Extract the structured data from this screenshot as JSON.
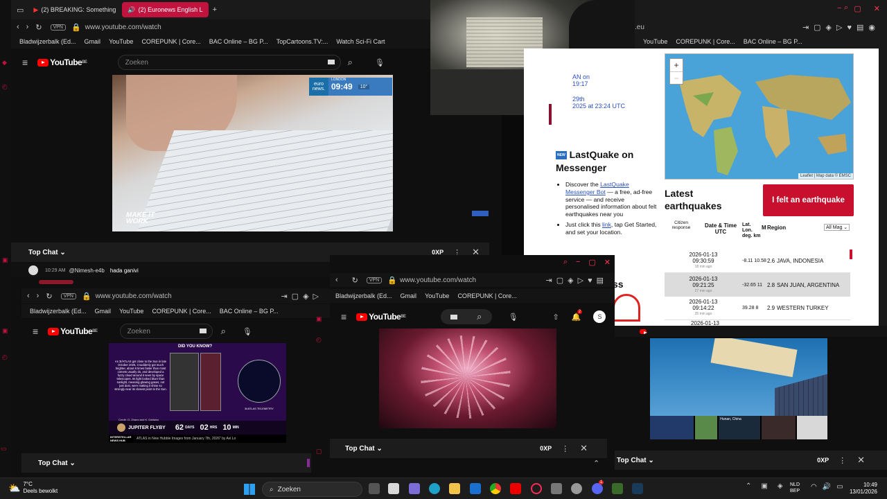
{
  "top_left_window": {
    "tabs": [
      "(2) BREAKING: Something",
      "(2) Euronews English L"
    ],
    "vpn": "VPN",
    "url": "www.youtube.com/watch",
    "bookmarks": [
      "Bladwijzerbalk (Ed...",
      "Gmail",
      "YouTube",
      "COREPUNK | Core...",
      "BAC Online – BG P...",
      "TopCartoons.TV:...",
      "Watch Sci-Fi Cart"
    ],
    "search_placeholder": "Zoeken",
    "badge": "BE",
    "logo": "YouTube",
    "overlay_city": "LONDON",
    "overlay_time": "09:49",
    "overlay_temp": "10°",
    "overlay_brand": "euro news.",
    "caption": "MAKE IT WORK",
    "chat_title": "Top Chat",
    "xp": "0XP",
    "chat_time": "10:29 AM",
    "chat_user": "@Nimesh-e4b",
    "chat_msg": "hada ganivi"
  },
  "right_window": {
    "url_tail": ".eu",
    "bookmarks": [
      "YouTube",
      "COREPUNK | Core...",
      "BAC Online – BG P..."
    ],
    "sidebar_snippets": [
      "AN on",
      "19:17",
      "29th",
      "2025 at 23:24 UTC"
    ],
    "messenger_title": "LastQuake on Messenger",
    "messenger_badge": "NEW",
    "messenger_item1_pre": "Discover the",
    "messenger_item1_link": "LastQuake Messenger Bot",
    "messenger_item1_post": "— a free, ad-free service — and receive personalised information about felt earthquakes near you",
    "messenger_item2_pre": "Just click this",
    "messenger_item2_link": "link",
    "messenger_item2_post": ", tap Get Started, and set your location.",
    "map_attrib": "Leaflet | Map data © EMSC",
    "zoom_in": "+",
    "zoom_out": "−",
    "latest_title": "Latest earthquakes",
    "felt_button": "I felt an earthquake",
    "col_citizen": "Citizen response",
    "col_datetime": "Date & Time UTC",
    "col_latlon": "Lat. Lon. deg. km",
    "col_mag": "M",
    "col_region": "Region",
    "mag_filter": "All Mag",
    "quakes": [
      {
        "date": "2026-01-13",
        "time": "09:30:59",
        "ago": "18 min ago",
        "latlon": "-8.11 10.58",
        "mag": "2.6",
        "region": "JAVA, INDONESIA"
      },
      {
        "date": "2026-01-13",
        "time": "09:21:25",
        "ago": "27 min ago",
        "latlon": "-32.65 11",
        "mag": "2.8",
        "region": "SAN JUAN, ARGENTINA"
      },
      {
        "date": "2026-01-13",
        "time": "09:14:22",
        "ago": "35 min ago",
        "latlon": "39.28 8",
        "mag": "2.9",
        "region": "WESTERN TURKEY"
      },
      {
        "date": "2026-01-13",
        "time": "",
        "ago": "",
        "latlon": "",
        "mag": "",
        "region": ""
      }
    ],
    "section_tail": "ss"
  },
  "bottom_left_window": {
    "url": "www.youtube.com/watch",
    "vpn": "VPN",
    "bookmarks": [
      "Bladwijzerbalk (Ed...",
      "Gmail",
      "YouTube",
      "COREPUNK | Core...",
      "BAC Online – BG P..."
    ],
    "search_placeholder": "Zoeken",
    "logo": "YouTube",
    "badge": "BE",
    "did_you_know": "DID YOU KNOW?",
    "fact": "As 3I/ATLAS got close to the Sun in late October 2025, it suddenly got much brighter, about 8 times faster than most comets usually do, and developed a fuzzy cloud around it seen by space telescopes. Its light looked bluer than sunlight, meaning glowing gases, not just dust, were making it shine so strongly near its closest point to the Sun.",
    "credit": "Credit: Q. Zhang and K. Dattaino",
    "telemetry": "3I/ATLAS TELEMETRY",
    "jupiter_label": "JUPITER FLYBY",
    "days": "62",
    "days_label": "DAYS",
    "hrs": "02",
    "hrs_label": "HRS",
    "mins": "10",
    "mins_label": "MIN",
    "brand": "INTERSTELLAR NEWS HUB",
    "ticker": "ATLAS in New Hubble Images from January 7th, 2026\" by Avi Lo",
    "chat_title": "Top Chat"
  },
  "bottom_mid_window": {
    "url": "www.youtube.com/watch",
    "vpn": "VPN",
    "bookmarks": [
      "Bladwijzerbalk (Ed...",
      "Gmail",
      "YouTube",
      "COREPUNK | Core..."
    ],
    "logo": "YouTube",
    "badge": "BE",
    "notif_count": "2",
    "avatar": "S",
    "chat_title": "Top Chat",
    "xp": "0XP"
  },
  "bottom_right_window": {
    "chat_title": "Top Chat",
    "xp": "0XP",
    "tile_label": "Hunan, China"
  },
  "taskbar": {
    "weather_temp": "7°C",
    "weather_desc": "Deels bewolkt",
    "search": "Zoeken",
    "lang": "NLD",
    "lang2": "BEP",
    "clock_time": "10:49",
    "clock_date": "13/01/2026",
    "discord_badge": "1"
  },
  "colors": {
    "accent": "#c2123e",
    "youtube_red": "#ff0000",
    "link": "#2a4fbf",
    "emsc_red": "#c8102e"
  }
}
